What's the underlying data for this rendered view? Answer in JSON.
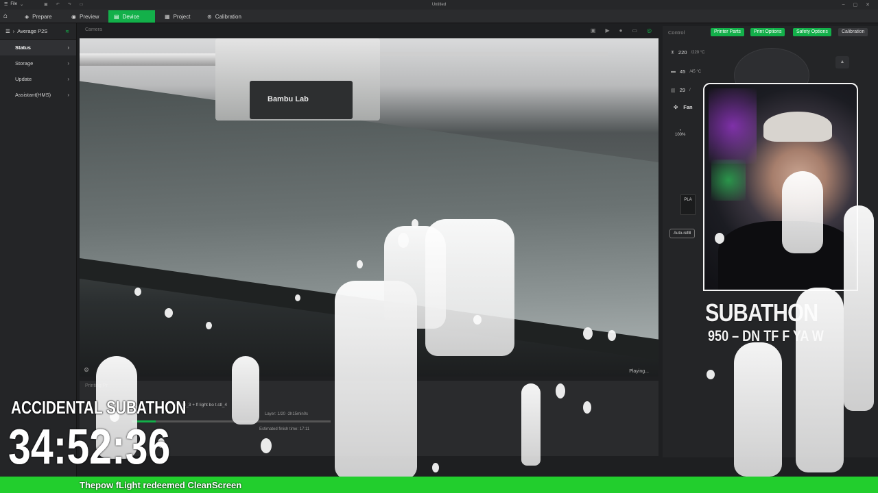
{
  "titlebar": {
    "file_menu": "File",
    "title": "Untitled"
  },
  "tabs": [
    {
      "label": "Prepare",
      "icon": "cube-icon"
    },
    {
      "label": "Preview",
      "icon": "eye-icon"
    },
    {
      "label": "Device",
      "icon": "printer-icon",
      "active": true
    },
    {
      "label": "Project",
      "icon": "document-icon"
    },
    {
      "label": "Calibration",
      "icon": "calibration-icon"
    }
  ],
  "sidebar": {
    "printer_name": "Average P2S",
    "items": [
      {
        "label": "Status",
        "active": true
      },
      {
        "label": "Storage"
      },
      {
        "label": "Update"
      },
      {
        "label": "Assistant(HMS)"
      }
    ]
  },
  "camera": {
    "header": "Camera",
    "brand_text": "Bambu Lab",
    "status": "Playing..."
  },
  "printing": {
    "header": "Printing Pr",
    "file_name": "int.stl_3 + fl light bo t.stl_4",
    "layer": "Layer: 1/20",
    "remaining": "-2h15min0s",
    "progress": 0.12,
    "finish_time": "Estimated finish time: 17:11"
  },
  "control": {
    "header": "Control",
    "buttons": [
      "Printer Parts",
      "Print Options",
      "Safety Options",
      "Calibration"
    ],
    "nozzle_temp": "220",
    "nozzle_target": "/220 °C",
    "bed_temp": "45",
    "bed_target": "/45 °C",
    "chamber_temp": "29",
    "chamber_target": "/",
    "fan_label": "Fan",
    "speed_pct": "100%",
    "ams_slot": "PLA",
    "auto_refill": "Auto-refill"
  },
  "overlay": {
    "subathon_title": "SUBATHON",
    "subathon_sub": "950 – DN TF F YA W",
    "accidental_title": "ACCIDENTAL SUBATHON",
    "timer": "34:52:36",
    "ticker": "Thepow fLight redeemed CleanScreen"
  },
  "colors": {
    "accent": "#13b04a",
    "ticker_bg": "#22ce2d"
  }
}
